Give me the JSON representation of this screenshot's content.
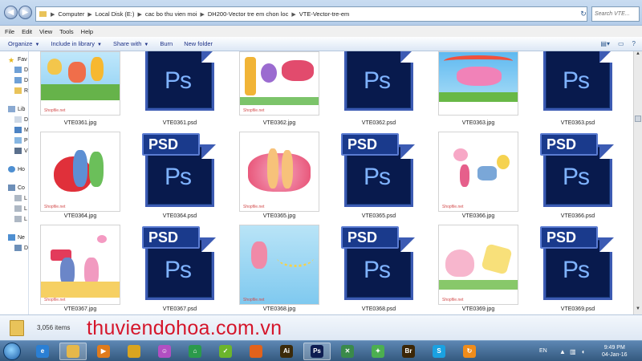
{
  "window": {
    "breadcrumb": [
      "Computer",
      "Local Disk (E:)",
      "cac bo thu vien moi",
      "DH200-Vector tre em chon loc",
      "VTE-Vector-tre-em"
    ],
    "search_placeholder": "Search VTE..."
  },
  "menu": [
    "File",
    "Edit",
    "View",
    "Tools",
    "Help"
  ],
  "commands": {
    "organize": "Organize",
    "include_in_library": "Include in library",
    "share_with": "Share with",
    "burn": "Burn",
    "new_folder": "New folder"
  },
  "nav": {
    "favorites": "Fav",
    "libraries": "Lib",
    "homegroup": "Ho",
    "computer": "Co",
    "network": "Ne",
    "sub_items": [
      "D",
      "D",
      "R",
      "D",
      "M",
      "P",
      "V",
      "L",
      "L",
      "L",
      "D"
    ]
  },
  "files": [
    {
      "name": "VTE0361.jpg",
      "type": "jpg"
    },
    {
      "name": "VTE0361.psd",
      "type": "psd"
    },
    {
      "name": "VTE0362.jpg",
      "type": "jpg"
    },
    {
      "name": "VTE0362.psd",
      "type": "psd"
    },
    {
      "name": "VTE0363.jpg",
      "type": "jpg"
    },
    {
      "name": "VTE0363.psd",
      "type": "psd"
    },
    {
      "name": "VTE0364.jpg",
      "type": "jpg"
    },
    {
      "name": "VTE0364.psd",
      "type": "psd"
    },
    {
      "name": "VTE0365.jpg",
      "type": "jpg"
    },
    {
      "name": "VTE0365.psd",
      "type": "psd"
    },
    {
      "name": "VTE0366.jpg",
      "type": "jpg"
    },
    {
      "name": "VTE0366.psd",
      "type": "psd"
    },
    {
      "name": "VTE0367.jpg",
      "type": "jpg"
    },
    {
      "name": "VTE0367.psd",
      "type": "psd"
    },
    {
      "name": "VTE0368.jpg",
      "type": "jpg"
    },
    {
      "name": "VTE0368.psd",
      "type": "psd"
    },
    {
      "name": "VTE0369.jpg",
      "type": "jpg"
    },
    {
      "name": "VTE0369.psd",
      "type": "psd"
    }
  ],
  "psd_icon": {
    "tab_text": "PSD",
    "logo_text": "Ps"
  },
  "thumb_watermark": "Shopfile.net",
  "details": {
    "item_count": "3,056 items",
    "site_watermark": "thuviendohoa.com.vn"
  },
  "taskbar": {
    "apps": [
      {
        "icon": "ie-icon",
        "glyph": "e",
        "color": "#2a7fd4"
      },
      {
        "icon": "explorer-icon",
        "glyph": "",
        "color": "#e6b84a",
        "active": true
      },
      {
        "icon": "media-player-icon",
        "glyph": "▶",
        "color": "#e07b1c"
      },
      {
        "icon": "chrome-icon",
        "glyph": "",
        "color": "#d9a41f"
      },
      {
        "icon": "chat-icon",
        "glyph": "☺",
        "color": "#b24fc2"
      },
      {
        "icon": "home-app-icon",
        "glyph": "⌂",
        "color": "#2b9a4b"
      },
      {
        "icon": "lime-app-icon",
        "glyph": "✓",
        "color": "#6cb52c"
      },
      {
        "icon": "firefox-icon",
        "glyph": "",
        "color": "#e2621b"
      },
      {
        "icon": "illustrator-icon",
        "glyph": "Ai",
        "color": "#3b2a0a"
      },
      {
        "icon": "photoshop-icon",
        "glyph": "Ps",
        "color": "#0e1d52",
        "active": true
      },
      {
        "icon": "tool-icon",
        "glyph": "✕",
        "color": "#3a8a4a"
      },
      {
        "icon": "green-app-icon",
        "glyph": "✦",
        "color": "#4caf50"
      },
      {
        "icon": "bridge-icon",
        "glyph": "Br",
        "color": "#3b2607"
      },
      {
        "icon": "skype-icon",
        "glyph": "S",
        "color": "#1aa1e1"
      },
      {
        "icon": "updater-icon",
        "glyph": "↻",
        "color": "#f08c1a"
      }
    ],
    "language": "EN",
    "time": "9:49 PM",
    "date": "04-Jan-16"
  }
}
